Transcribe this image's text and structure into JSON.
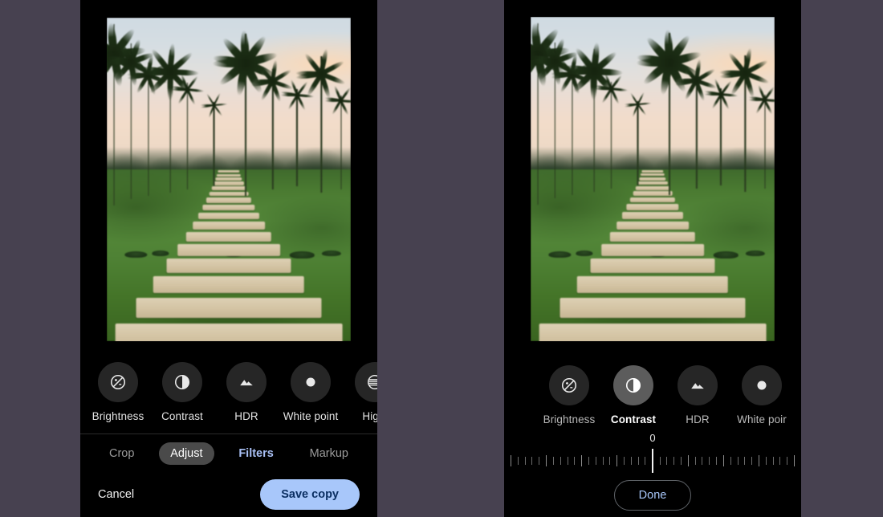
{
  "background_color": "#474150",
  "panels": [
    {
      "id": "left",
      "name": "photo-editor-adjust-tab",
      "photo": {
        "alt": "Tropical park at sunset with palm trees and a stone paver path across a lawn"
      },
      "adjustments": [
        {
          "label": "Brightness",
          "icon": "brightness-icon",
          "selected": false
        },
        {
          "label": "Contrast",
          "icon": "contrast-icon",
          "selected": false
        },
        {
          "label": "HDR",
          "icon": "hdr-icon",
          "selected": false
        },
        {
          "label": "White point",
          "icon": "white-point-icon",
          "selected": false
        },
        {
          "label": "Highl",
          "icon": "highlights-icon",
          "selected": false
        }
      ],
      "tabs": [
        {
          "label": "Crop",
          "state": "normal"
        },
        {
          "label": "Adjust",
          "state": "selected"
        },
        {
          "label": "Filters",
          "state": "accent"
        },
        {
          "label": "Markup",
          "state": "normal"
        }
      ],
      "actions": {
        "cancel_label": "Cancel",
        "save_label": "Save copy",
        "save_bg": "#a8c7fa",
        "save_fg": "#0b2f62"
      }
    },
    {
      "id": "right",
      "name": "photo-editor-contrast-slider",
      "photo": {
        "alt": "Tropical park at sunset with palm trees and a stone paver path across a lawn"
      },
      "adjustments": [
        {
          "label": "Brightness",
          "icon": "brightness-icon",
          "selected": false
        },
        {
          "label": "Contrast",
          "icon": "contrast-icon",
          "selected": true
        },
        {
          "label": "HDR",
          "icon": "hdr-icon",
          "selected": false
        },
        {
          "label": "White poir",
          "icon": "white-point-icon",
          "selected": false
        }
      ],
      "slider": {
        "name": "contrast-slider",
        "value": "0",
        "min": -50,
        "max": 50,
        "tick_count": 41,
        "center_index": 20,
        "major_every": 5
      },
      "actions": {
        "done_label": "Done",
        "done_fg": "#a8c7fa",
        "done_border": "#5f6368"
      }
    }
  ]
}
